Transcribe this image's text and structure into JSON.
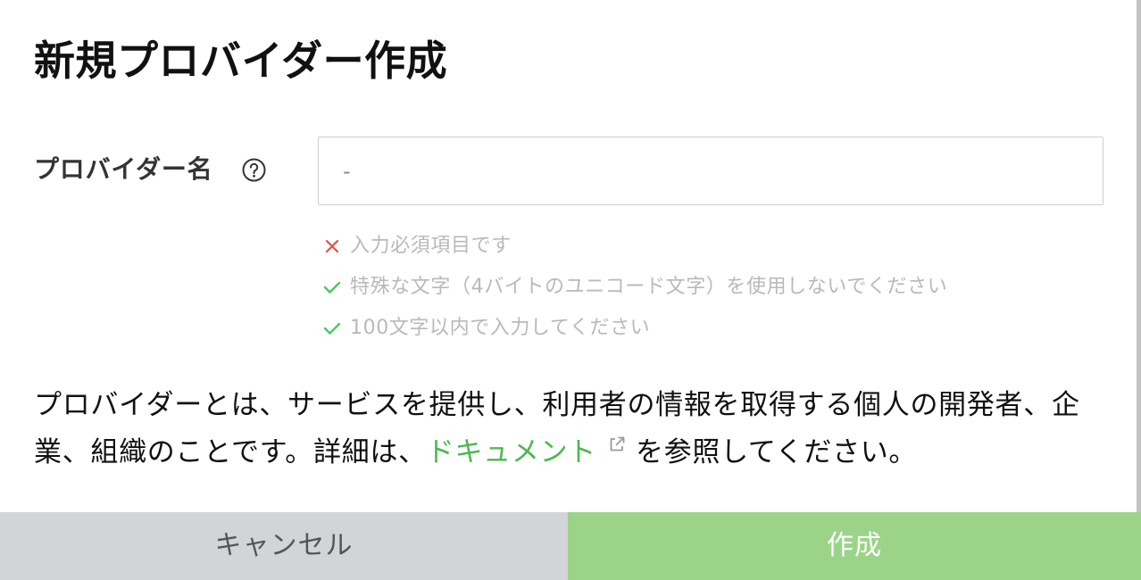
{
  "title": "新規プロバイダー作成",
  "form": {
    "provider_name_label": "プロバイダー名",
    "help_icon": "question-circle-icon",
    "provider_name_placeholder": "-",
    "provider_name_value": ""
  },
  "validation": [
    {
      "status": "error",
      "icon": "cross-icon",
      "text": "入力必須項目です"
    },
    {
      "status": "ok",
      "icon": "check-icon",
      "text": "特殊な文字（4バイトのユニコード文字）を使用しないでください"
    },
    {
      "status": "ok",
      "icon": "check-icon",
      "text": "100文字以内で入力してください"
    }
  ],
  "description": {
    "before": "プロバイダーとは、サービスを提供し、利用者の情報を取得する個人の開発者、企業、組織のことです。詳細は、",
    "link_text": "ドキュメント",
    "link_icon": "external-link-icon",
    "after": "を参照してください。"
  },
  "footer": {
    "cancel_label": "キャンセル",
    "create_label": "作成"
  },
  "colors": {
    "error": "#e4514a",
    "success": "#4cc764",
    "link": "#4cb84c",
    "create_button": "#9bd488",
    "cancel_button": "#d2d4d8"
  }
}
